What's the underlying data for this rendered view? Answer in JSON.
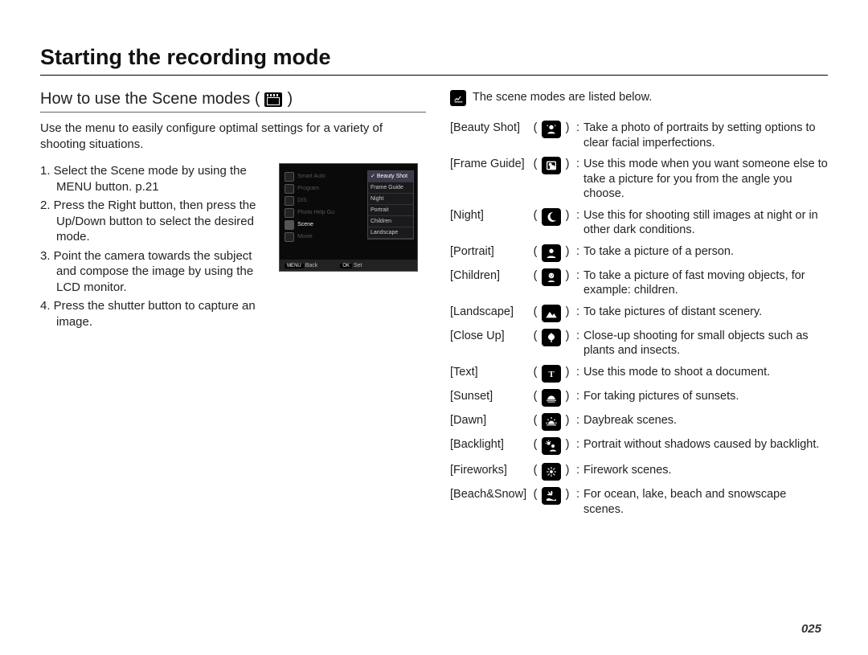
{
  "page": {
    "title": "Starting the recording mode",
    "number": "025"
  },
  "left": {
    "subtitle_prefix": "How to use the Scene modes (",
    "subtitle_suffix": ")",
    "intro": "Use the menu to easily configure optimal settings for a variety of shooting situations.",
    "step1": "1. Select the Scene mode by using the MENU button. p.21",
    "step2": "2. Press the Right button, then press the Up/Down button to select the desired mode.",
    "step3": "3. Point the camera towards the subject and compose the image by using the LCD monitor.",
    "step4": "4. Press the shutter button to capture an image.",
    "lcd": {
      "menu": {
        "i0": "Smart Auto",
        "i1": "Program",
        "i2": "DIS",
        "i3": "Photo Help Gu",
        "i4": "Scene",
        "i5": "Movie"
      },
      "sub": {
        "s0": "Beauty Shot",
        "s1": "Frame Guide",
        "s2": "Night",
        "s3": "Portrait",
        "s4": "Children",
        "s5": "Landscape"
      },
      "back_btn": "MENU",
      "back_label": "Back",
      "set_btn": "OK",
      "set_label": "Set"
    }
  },
  "right": {
    "note": "The scene modes are listed below.",
    "scenes": {
      "beauty": {
        "label": "[Beauty Shot]",
        "desc": "Take a photo of portraits by setting options to clear facial imperfections."
      },
      "frame": {
        "label": "[Frame Guide]",
        "desc": "Use this mode when you want someone else to take a picture for you from the angle you choose."
      },
      "night": {
        "label": "[Night]",
        "desc": "Use this for shooting still images at night or in other dark conditions."
      },
      "portrait": {
        "label": "[Portrait]",
        "desc": "To take a picture of a person."
      },
      "children": {
        "label": "[Children]",
        "desc": "To take a picture of fast moving objects, for example: children."
      },
      "landscape": {
        "label": "[Landscape]",
        "desc": "To take pictures of distant scenery."
      },
      "closeup": {
        "label": "[Close Up]",
        "desc": "Close-up shooting for small objects such as plants and insects."
      },
      "text": {
        "label": "[Text]",
        "desc": "Use this mode to shoot a document."
      },
      "sunset": {
        "label": "[Sunset]",
        "desc": "For taking pictures of sunsets."
      },
      "dawn": {
        "label": "[Dawn]",
        "desc": "Daybreak scenes."
      },
      "backlight": {
        "label": "[Backlight]",
        "desc": "Portrait without shadows caused by backlight."
      },
      "fireworks": {
        "label": "[Fireworks]",
        "desc": "Firework scenes."
      },
      "beachsnow": {
        "label": "[Beach&Snow]",
        "desc": "For ocean, lake, beach and snowscape scenes."
      }
    }
  }
}
